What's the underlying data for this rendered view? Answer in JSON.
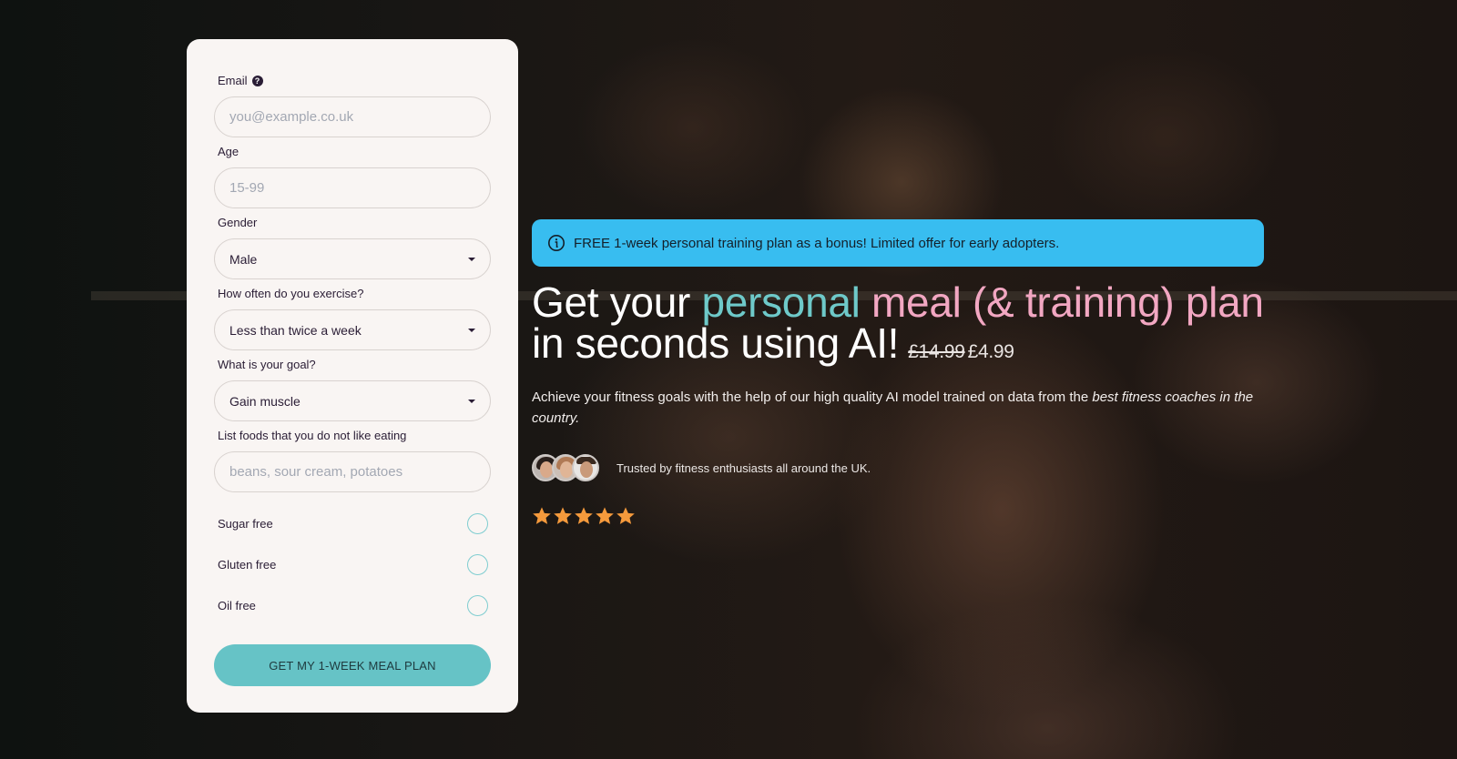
{
  "form": {
    "email": {
      "label": "Email",
      "placeholder": "you@example.co.uk",
      "value": ""
    },
    "age": {
      "label": "Age",
      "placeholder": "15-99",
      "value": ""
    },
    "gender": {
      "label": "Gender",
      "selected": "Male"
    },
    "exercise": {
      "label": "How often do you exercise?",
      "selected": "Less than twice a week"
    },
    "goal": {
      "label": "What is your goal?",
      "selected": "Gain muscle"
    },
    "dislikes": {
      "label": "List foods that you do not like eating",
      "placeholder": "beans, sour cream, potatoes",
      "value": ""
    },
    "checkboxes": [
      {
        "label": "Sugar free",
        "checked": false
      },
      {
        "label": "Gluten free",
        "checked": false
      },
      {
        "label": "Oil free",
        "checked": false
      }
    ],
    "submit_label": "GET MY 1-WEEK MEAL PLAN"
  },
  "banner": {
    "icon": "info-circle-icon",
    "text": "FREE 1-week personal training plan as a bonus! Limited offer for early adopters."
  },
  "headline": {
    "part1": "Get your ",
    "part2": "personal",
    "part3": " meal (& training) plan",
    "part4": "in seconds using AI!",
    "price_old": "£14.99",
    "price_new": "£4.99"
  },
  "description": {
    "text": "Achieve your fitness goals with the help of our high quality AI model trained on data from the ",
    "emphasis": "best fitness coaches in the country."
  },
  "trust": {
    "text": "Trusted by fitness enthusiasts all around the UK.",
    "avatar_count": 3
  },
  "rating": {
    "stars": 5,
    "max": 5
  },
  "colors": {
    "accent_teal": "#66c3c6",
    "accent_pink": "#f2a7c2",
    "banner_blue": "#38bdf0",
    "star_orange": "#f59a3c"
  }
}
